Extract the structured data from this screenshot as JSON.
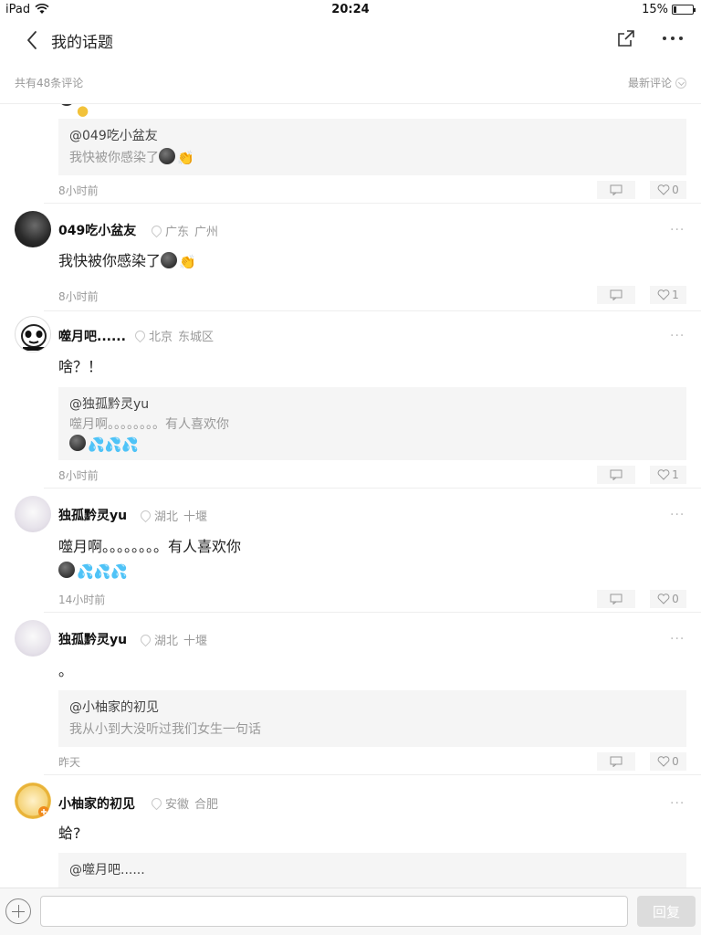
{
  "status_bar": {
    "device": "iPad",
    "time": "20:24",
    "battery_percent": "15%",
    "battery_level": 0.15
  },
  "nav": {
    "title": "我的话题"
  },
  "sub_header": {
    "count": "共有48条评论",
    "sort_label": "最新评论"
  },
  "comments": [
    {
      "quote_user": "@049吃小盆友",
      "quote_text": "我快被你感染了",
      "time": "8小时前",
      "likes": "0"
    },
    {
      "user": "049吃小盆友",
      "province": "广东",
      "city": "广州",
      "text": "我快被你感染了",
      "time": "8小时前",
      "likes": "1"
    },
    {
      "user": "噬月吧......",
      "province": "北京",
      "city": "东城区",
      "text": "啥？！",
      "quote_user": "@独孤黔灵yu",
      "quote_text": "噬月啊。。。。。。。。有人喜欢你",
      "time": "8小时前",
      "likes": "1"
    },
    {
      "user": "独孤黔灵yu",
      "province": "湖北",
      "city": "十堰",
      "text": "噬月啊。。。。。。。。有人喜欢你",
      "time": "14小时前",
      "likes": "0"
    },
    {
      "user": "独孤黔灵yu",
      "province": "湖北",
      "city": "十堰",
      "text": "。",
      "quote_user": "@小柚家的初见",
      "quote_text": "我从小到大没听过我们女生一句话",
      "time": "昨天",
      "likes": "0"
    },
    {
      "user": "小柚家的初见",
      "province": "安徽",
      "city": "合肥",
      "text": "蛤?",
      "quote_user": "@噬月吧......"
    }
  ],
  "bottom_bar": {
    "input_placeholder": "",
    "send_label": "回复"
  },
  "colors": {
    "muted_text": "#999999",
    "quote_bg": "#f5f5f5",
    "divider": "#eeeeee",
    "send_disabled": "#dcdcdc"
  }
}
